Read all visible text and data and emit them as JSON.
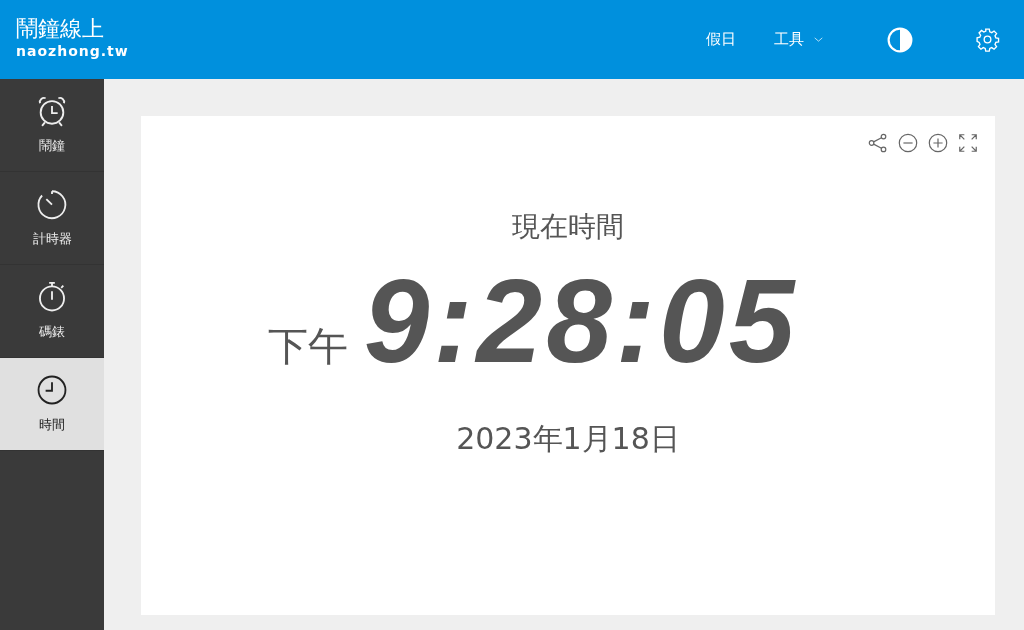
{
  "header": {
    "title": "鬧鐘線上",
    "subtitle": "naozhong.tw",
    "nav": [
      {
        "label": "假日",
        "kind": "link"
      },
      {
        "label": "工具",
        "kind": "dropdown"
      }
    ]
  },
  "sidebar": {
    "items": [
      {
        "label": "鬧鐘",
        "kind": "alarm",
        "selected": false
      },
      {
        "label": "計時器",
        "kind": "timer",
        "selected": false
      },
      {
        "label": "碼錶",
        "kind": "stopwatch",
        "selected": false
      },
      {
        "label": "時間",
        "kind": "clock",
        "selected": true
      }
    ]
  },
  "clock": {
    "heading": "現在時間",
    "period": "下午",
    "time": "9:28:05",
    "date": "2023年1月18日"
  }
}
